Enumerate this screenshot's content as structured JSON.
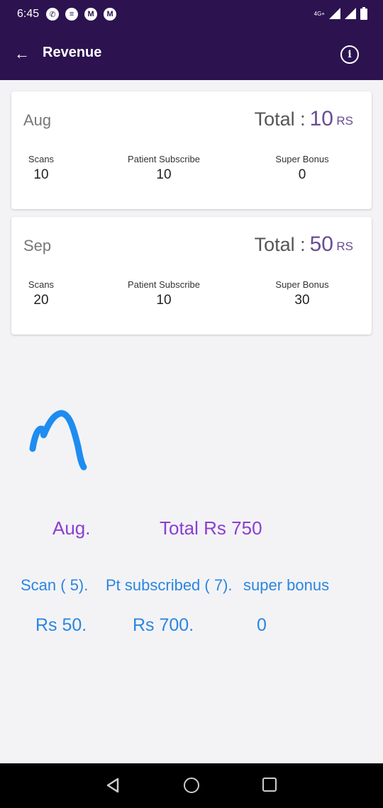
{
  "status_bar": {
    "time": "6:45",
    "network": "4G+",
    "icons": [
      "whatsapp-icon",
      "message-icon",
      "gmail-icon",
      "gmail-icon",
      "signal-icon",
      "signal-icon",
      "battery-icon"
    ],
    "glyphs": [
      "✆",
      "≡",
      "M",
      "M"
    ]
  },
  "app_bar": {
    "title": "Revenue",
    "back_glyph": "←",
    "info_glyph": "i"
  },
  "cards": [
    {
      "month": "Aug",
      "total_label": "Total :",
      "total_value": "10",
      "total_unit": "RS",
      "stats": [
        {
          "label": "Scans",
          "value": "10"
        },
        {
          "label": "Patient Subscribe",
          "value": "10"
        },
        {
          "label": "Super Bonus",
          "value": "0"
        }
      ]
    },
    {
      "month": "Sep",
      "total_label": "Total :",
      "total_value": "50",
      "total_unit": "RS",
      "stats": [
        {
          "label": "Scans",
          "value": "20"
        },
        {
          "label": "Patient Subscribe",
          "value": "10"
        },
        {
          "label": "Super Bonus",
          "value": "30"
        }
      ]
    }
  ],
  "annotation": {
    "month": "Aug.",
    "total": "Total Rs 750",
    "scan": "Scan ( 5).",
    "pt_subscribed": "Pt subscribed ( 7).",
    "super_bonus": "super bonus",
    "scan_amount": "Rs 50.",
    "pt_amount": "Rs 700.",
    "bonus_amount": "0"
  },
  "colors": {
    "app_bar": "#2c1350",
    "accent_purple": "#6a4c93",
    "annotation_blue": "#2b86e0",
    "annotation_purple": "#8a3fd0"
  }
}
